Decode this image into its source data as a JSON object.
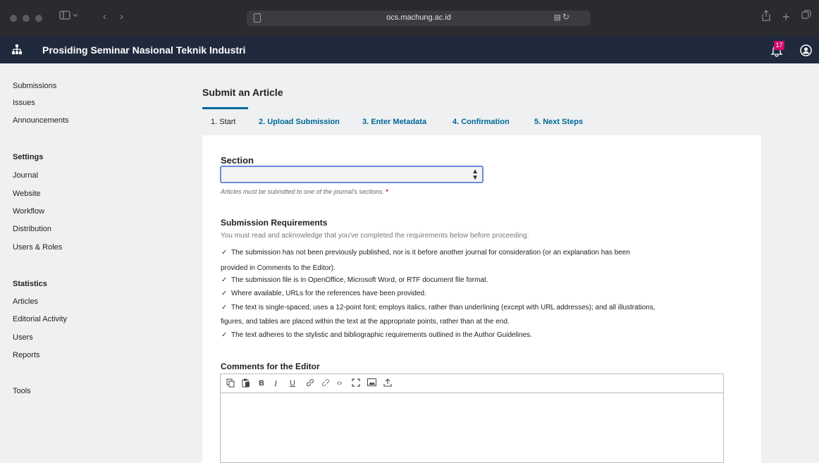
{
  "browser": {
    "url": "ocs.machung.ac.id"
  },
  "header": {
    "site_title": "Prosiding Seminar Nasional Teknik Industri",
    "notification_count": "17"
  },
  "sidebar": {
    "items": [
      "Submissions",
      "Issues",
      "Announcements"
    ],
    "settings_heading": "Settings",
    "settings_items": [
      "Journal",
      "Website",
      "Workflow",
      "Distribution",
      "Users & Roles"
    ],
    "statistics_heading": "Statistics",
    "statistics_items": [
      "Articles",
      "Editorial Activity",
      "Users",
      "Reports"
    ],
    "tools": "Tools"
  },
  "main": {
    "title": "Submit an Article",
    "tabs": [
      "1. Start",
      "2. Upload Submission",
      "3. Enter Metadata",
      "4. Confirmation",
      "5. Next Steps"
    ],
    "active_tab": "1. Start",
    "section": {
      "label": "Section",
      "selected_value": "",
      "help": "Articles must be submitted to one of the journal's sections.",
      "required_mark": "*"
    },
    "requirements": {
      "heading": "Submission Requirements",
      "intro": "You must read and acknowledge that you've completed the requirements below before proceeding.",
      "lines": [
        "The submission has not been previously published, nor is it before another journal for consideration (or an explanation has been",
        "provided in Comments to the Editor).",
        "The submission file is in OpenOffice, Microsoft Word, or RTF document file format.",
        "Where available, URLs for the references have been provided.",
        "The text is single-spaced; uses a 12-point font; employs italics, rather than underlining (except with URL addresses); and all illustrations,",
        "figures, and tables are placed within the text at the appropriate points, rather than at the end.",
        "The text adheres to the stylistic and bibliographic requirements outlined in the Author Guidelines."
      ]
    },
    "comments": {
      "label": "Comments for the Editor"
    }
  },
  "colors": {
    "accent": "#006798",
    "header_bg": "#1f2b3d",
    "badge": "#d00a6c"
  },
  "icons": [
    "sidebar-toggle-icon",
    "back-icon",
    "forward-icon",
    "shield-icon",
    "translate-icon",
    "reload-icon",
    "share-icon",
    "new-tab-icon",
    "tabs-overview-icon",
    "site-icon",
    "bell-icon",
    "user-icon",
    "copy-icon",
    "paste-icon",
    "link-icon",
    "unlink-icon",
    "code-icon",
    "fullscreen-icon",
    "image-icon",
    "upload-icon",
    "checkmark-icon",
    "select-arrows-icon"
  ]
}
